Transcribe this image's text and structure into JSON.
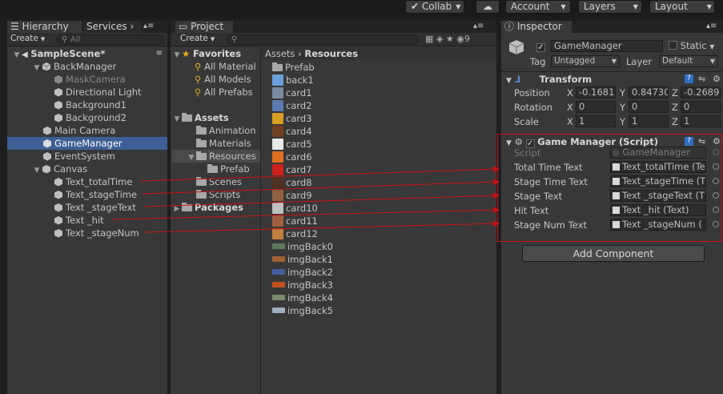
{
  "toolbar": {
    "collab": "Collab",
    "account": "Account",
    "layers": "Layers",
    "layout": "Layout",
    "cloud_icon": "cloud-icon"
  },
  "hierarchy": {
    "tab_label": "Hierarchy",
    "services_label": "Services",
    "create_label": "Create",
    "search_placeholder": "All",
    "scene_name": "SampleScene*",
    "items": [
      {
        "label": "BackManager"
      },
      {
        "label": "MaskCamera"
      },
      {
        "label": "Directional Light"
      },
      {
        "label": "Background1"
      },
      {
        "label": "Background2"
      },
      {
        "label": "Main Camera"
      },
      {
        "label": "GameManager"
      },
      {
        "label": "EventSystem"
      },
      {
        "label": "Canvas"
      },
      {
        "label": "Text_totalTime"
      },
      {
        "label": "Text_stageTime"
      },
      {
        "label": "Text _stageText"
      },
      {
        "label": "Text _hit"
      },
      {
        "label": "Text _stageNum"
      }
    ]
  },
  "project": {
    "tab_label": "Project",
    "create_label": "Create",
    "tree": {
      "favorites": "Favorites",
      "fav_items": [
        "All Material",
        "All Models",
        "All Prefabs"
      ],
      "assets": "Assets",
      "asset_items": [
        "Animation",
        "Materials",
        "Resources",
        "Prefab",
        "Scenes",
        "Scripts"
      ],
      "packages": "Packages"
    },
    "breadcrumb": {
      "root": "Assets",
      "current": "Resources"
    },
    "badge_count": "9",
    "files": [
      "Prefab",
      "back1",
      "card1",
      "card2",
      "card3",
      "card4",
      "card5",
      "card6",
      "card7",
      "card8",
      "card9",
      "card10",
      "card11",
      "card12",
      "imgBack0",
      "imgBack1",
      "imgBack2",
      "imgBack3",
      "imgBack4",
      "imgBack5"
    ],
    "file_colors": [
      "#a8a8a8",
      "#6a9fd8",
      "#7a8aa0",
      "#5a7ab0",
      "#d8a020",
      "#704020",
      "#e8e8e8",
      "#e07020",
      "#d02020",
      "#503020",
      "#906040",
      "#c0c0c0",
      "#a06040",
      "#c08040",
      "#5a7a5a",
      "#a06030",
      "#4060a0",
      "#c05020",
      "#7a8a6a",
      "#a0b0c0"
    ]
  },
  "inspector": {
    "tab_label": "Inspector",
    "object_name": "GameManager",
    "static_label": "Static",
    "tag_label": "Tag",
    "tag_value": "Untagged",
    "layer_label": "Layer",
    "layer_value": "Default",
    "transform": {
      "title": "Transform",
      "position_label": "Position",
      "rotation_label": "Rotation",
      "scale_label": "Scale",
      "pos": {
        "x": "-0.1681",
        "y": "0.84730",
        "z": "-0.2689"
      },
      "rot": {
        "x": "0",
        "y": "0",
        "z": "0"
      },
      "scl": {
        "x": "1",
        "y": "1",
        "z": "1"
      }
    },
    "script_comp": {
      "title": "Game Manager (Script)",
      "script_label": "Script",
      "script_value": "GameManager",
      "fields": [
        {
          "label": "Total Time Text",
          "value": "Text_totalTime (Te"
        },
        {
          "label": "Stage Time Text",
          "value": "Text_stageTime (T"
        },
        {
          "label": "Stage Text",
          "value": "Text _stageText (T"
        },
        {
          "label": "Hit Text",
          "value": "Text _hit (Text)"
        },
        {
          "label": "Stage Num Text",
          "value": "Text _stageNum ("
        }
      ]
    },
    "add_component": "Add Component"
  },
  "colors": {
    "arrow": "#cc1111",
    "selection": "#3e5f96",
    "highlight_box": "#cc1111"
  }
}
